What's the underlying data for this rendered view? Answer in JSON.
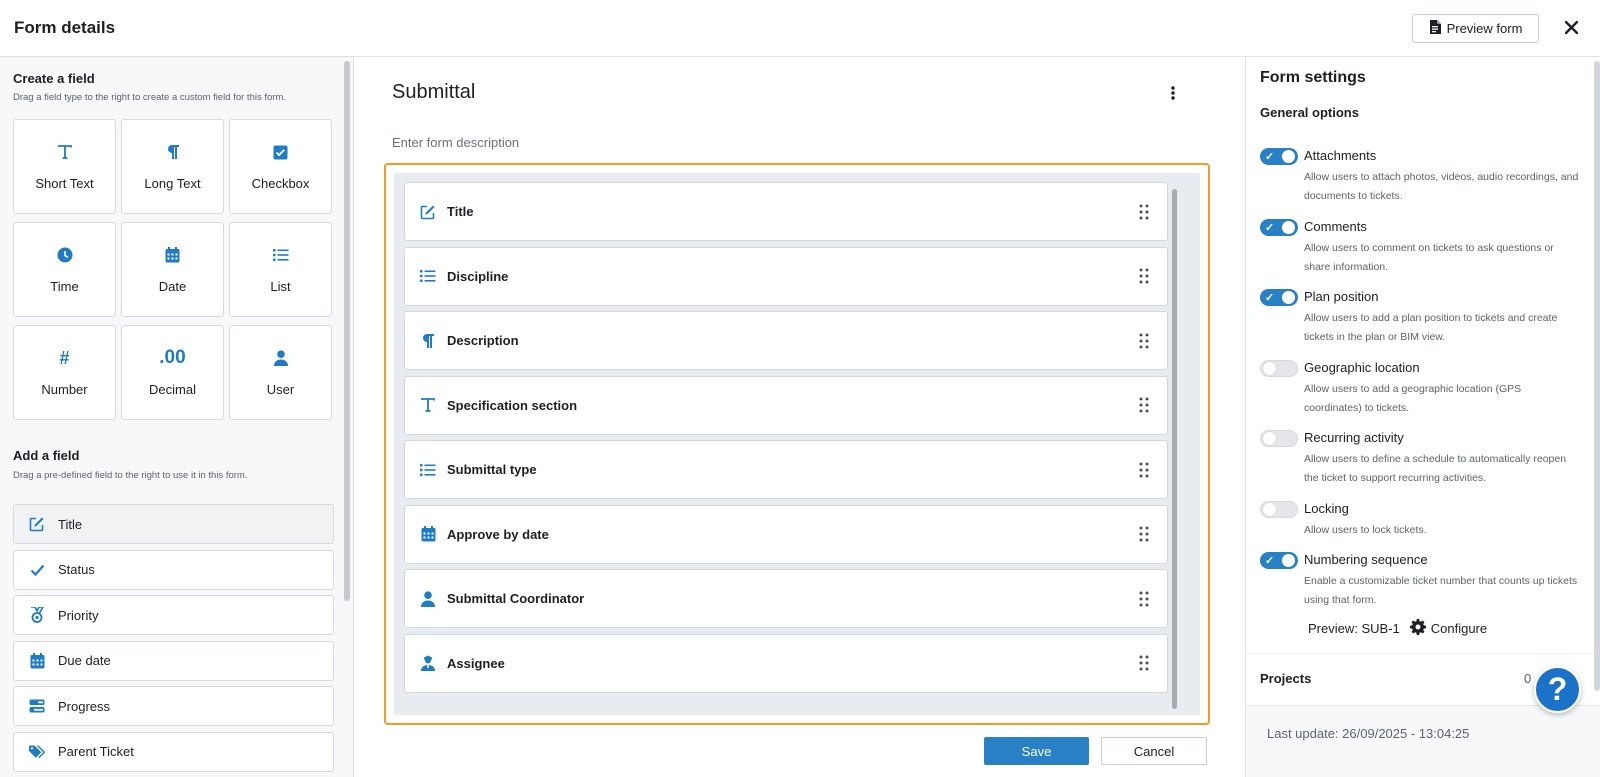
{
  "header": {
    "title": "Form details",
    "preview_label": "Preview form",
    "close_icon": "close-icon"
  },
  "create_field": {
    "title": "Create a field",
    "subtitle": "Drag a field type to the right to create a custom field for this form.",
    "types": [
      {
        "label": "Short Text",
        "icon": "text-t-icon"
      },
      {
        "label": "Long Text",
        "icon": "paragraph-icon"
      },
      {
        "label": "Checkbox",
        "icon": "checkbox-icon"
      },
      {
        "label": "Time",
        "icon": "clock-icon"
      },
      {
        "label": "Date",
        "icon": "calendar-icon"
      },
      {
        "label": "List",
        "icon": "list-icon"
      },
      {
        "label": "Number",
        "icon": "hash-icon"
      },
      {
        "label": "Decimal",
        "icon": "decimal-icon"
      },
      {
        "label": "User",
        "icon": "user-icon"
      }
    ]
  },
  "add_field": {
    "title": "Add a field",
    "subtitle": "Drag a pre-defined field to the right to use it in this form.",
    "items": [
      {
        "label": "Title",
        "icon": "edit-icon"
      },
      {
        "label": "Status",
        "icon": "check-icon"
      },
      {
        "label": "Priority",
        "icon": "medal-icon"
      },
      {
        "label": "Due date",
        "icon": "calendar-icon"
      },
      {
        "label": "Progress",
        "icon": "progress-icon"
      },
      {
        "label": "Parent Ticket",
        "icon": "tag-icon"
      }
    ]
  },
  "form": {
    "name": "Submittal",
    "description_placeholder": "Enter form description",
    "fields": [
      {
        "label": "Title",
        "icon": "edit-icon"
      },
      {
        "label": "Discipline",
        "icon": "list-icon"
      },
      {
        "label": "Description",
        "icon": "paragraph-icon"
      },
      {
        "label": "Specification section",
        "icon": "text-t-icon"
      },
      {
        "label": "Submittal type",
        "icon": "list-icon"
      },
      {
        "label": "Approve by date",
        "icon": "calendar-icon"
      },
      {
        "label": "Submittal Coordinator",
        "icon": "user-icon"
      },
      {
        "label": "Assignee",
        "icon": "user-tie-icon"
      }
    ],
    "save_label": "Save",
    "cancel_label": "Cancel"
  },
  "settings": {
    "title": "Form settings",
    "general_label": "General options",
    "options": [
      {
        "name": "Attachments",
        "enabled": true,
        "desc": "Allow users to attach photos, videos, audio recordings, and documents to tickets."
      },
      {
        "name": "Comments",
        "enabled": true,
        "desc": "Allow users to comment on tickets to ask questions or share information."
      },
      {
        "name": "Plan position",
        "enabled": true,
        "desc": "Allow users to add a plan position to tickets and create tickets in the plan or BIM view."
      },
      {
        "name": "Geographic location",
        "enabled": false,
        "desc": "Allow users to add a geographic location (GPS coordinates) to tickets."
      },
      {
        "name": "Recurring activity",
        "enabled": false,
        "desc": "Allow users to define a schedule to automatically reopen the ticket to support recurring activities."
      },
      {
        "name": "Locking",
        "enabled": false,
        "desc": "Allow users to lock tickets."
      },
      {
        "name": "Numbering sequence",
        "enabled": true,
        "desc": "Enable a customizable ticket number that counts up tickets using that form."
      }
    ],
    "preview_text": "Preview: SUB-1",
    "configure_label": "Configure",
    "projects_label": "Projects",
    "projects_count": "0",
    "last_update": "Last update: 26/09/2025 - 13:04:25"
  },
  "help_label": "?",
  "colors": {
    "accent": "#2781c4",
    "icon": "#1f7cc4",
    "drop_border": "#f39a1f"
  }
}
